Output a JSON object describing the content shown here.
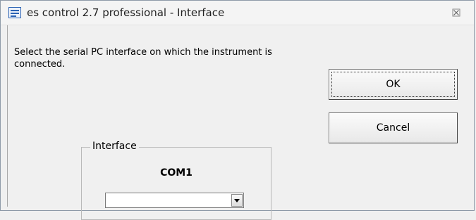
{
  "window": {
    "title": "es control 2.7 professional - Interface",
    "icon": "form-window-icon",
    "close_icon": "close-icon"
  },
  "dialog": {
    "instruction": "Select the serial PC interface on which the instrument is connected.",
    "ok_label": "OK",
    "cancel_label": "Cancel"
  },
  "interface_group": {
    "legend": "Interface",
    "selected_port": "COM1",
    "combo_value": "",
    "combo_icon": "dropdown-arrow-icon"
  }
}
